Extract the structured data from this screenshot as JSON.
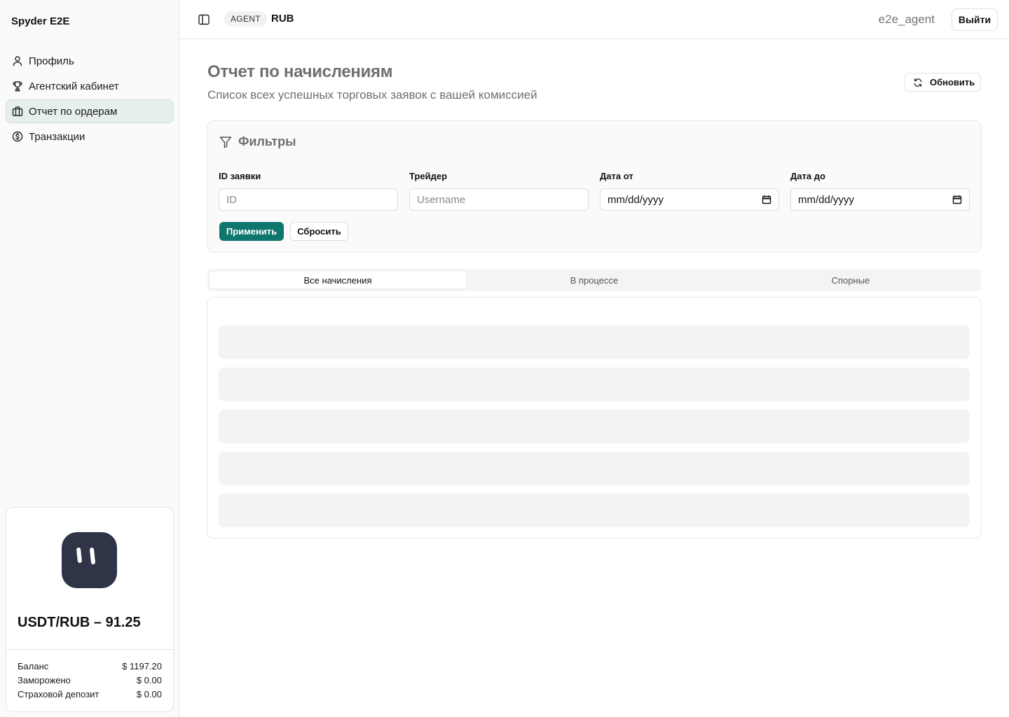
{
  "sidebar": {
    "brand": "Spyder E2E",
    "nav": [
      {
        "label": "Профиль",
        "icon": "user-icon"
      },
      {
        "label": "Агентский кабинет",
        "icon": "trophy-icon"
      },
      {
        "label": "Отчет по ордерам",
        "icon": "briefcase-icon",
        "active": true
      },
      {
        "label": "Транзакции",
        "icon": "dollar-circle-icon"
      }
    ],
    "wallet": {
      "rate": "USDT/RUB – 91.25",
      "rows": [
        {
          "label": "Баланс",
          "value": "$ 1197.20"
        },
        {
          "label": "Заморожено",
          "value": "$ 0.00"
        },
        {
          "label": "Страховой депозит",
          "value": "$ 0.00"
        }
      ]
    }
  },
  "header": {
    "role": "AGENT",
    "currency": "RUB",
    "username": "e2e_agent",
    "logout_label": "Выйти"
  },
  "page": {
    "title": "Отчет по начислениям",
    "subtitle": "Список всех успешных торговых заявок с вашей комиссией",
    "refresh_label": "Обновить"
  },
  "filters": {
    "title": "Фильтры",
    "fields": [
      {
        "label": "ID заявки",
        "placeholder": "ID"
      },
      {
        "label": "Трейдер",
        "placeholder": "Username"
      },
      {
        "label": "Дата от",
        "value": "mm/dd/yyyy"
      },
      {
        "label": "Дата до",
        "value": "mm/dd/yyyy"
      }
    ],
    "apply_label": "Применить",
    "reset_label": "Сбросить"
  },
  "tabs": [
    {
      "label": "Все начисления",
      "active": true
    },
    {
      "label": "В процессе"
    },
    {
      "label": "Спорные"
    }
  ],
  "colors": {
    "accent": "#0f766e",
    "active_nav_bg": "#e6efec",
    "logo_bg": "#2f3447"
  }
}
